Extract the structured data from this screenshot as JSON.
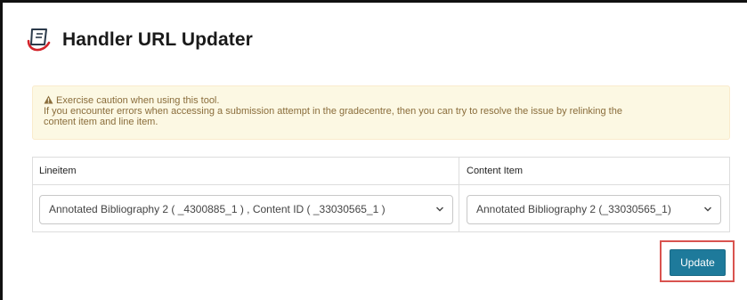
{
  "header": {
    "title": "Handler URL Updater",
    "logo_icon": "turnitin-logo-icon"
  },
  "alert": {
    "icon": "warning-triangle-icon",
    "line1": "Exercise caution when using this tool.",
    "line2": "If you encounter errors when accessing a submission attempt in the gradecentre, then you can try to resolve the issue by relinking the",
    "line3": "content item and line item.",
    "color": "#8a6d3b",
    "background": "#fcf8e3"
  },
  "table": {
    "headers": {
      "lineitem": "Lineitem",
      "content_item": "Content Item"
    },
    "lineitem_select": {
      "value": "Annotated Bibliography 2 ( _4300885_1 ) , Content ID ( _33030565_1 )"
    },
    "content_item_select": {
      "value": "Annotated Bibliography 2 (_33030565_1)"
    }
  },
  "actions": {
    "update_label": "Update",
    "update_color": "#1e7a9b",
    "highlight_color": "#d9534f"
  }
}
